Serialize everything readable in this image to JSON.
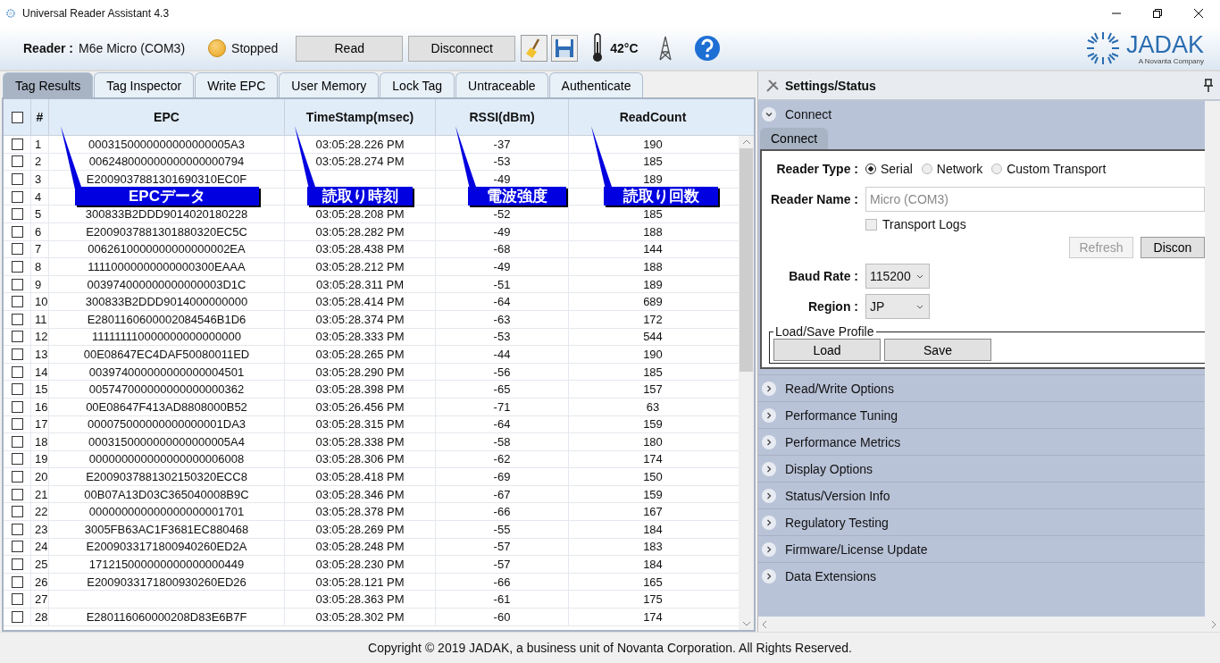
{
  "window": {
    "title": "Universal Reader Assistant 4.3"
  },
  "toolbar": {
    "reader_label": "Reader :",
    "reader_value": "M6e Micro (COM3)",
    "status": "Stopped",
    "buttons": [
      "Read",
      "Disconnect"
    ],
    "temperature": "42°C"
  },
  "logo": {
    "name": "JADAK",
    "tagline": "A Novanta Company"
  },
  "tabs": [
    {
      "label": "Tag Results",
      "selected": true
    },
    {
      "label": "Tag Inspector",
      "selected": false
    },
    {
      "label": "Write EPC",
      "selected": false
    },
    {
      "label": "User Memory",
      "selected": false
    },
    {
      "label": "Lock Tag",
      "selected": false
    },
    {
      "label": "Untraceable",
      "selected": false
    },
    {
      "label": "Authenticate",
      "selected": false
    }
  ],
  "table": {
    "select_all_checked": false,
    "columns": [
      "#",
      "EPC",
      "TimeStamp(msec)",
      "RSSI(dBm)",
      "ReadCount"
    ],
    "rows": [
      {
        "checked": false,
        "n": "1",
        "epc": "0003150000000000000005A3",
        "time": "03:05:28.226 PM",
        "rssi": "-37",
        "count": "190"
      },
      {
        "checked": false,
        "n": "2",
        "epc": "006248000000000000000794",
        "time": "03:05:28.274 PM",
        "rssi": "-53",
        "count": "185"
      },
      {
        "checked": false,
        "n": "3",
        "epc": "E2009037881301690310EC0F",
        "time": null,
        "rssi": "-49",
        "count": "189"
      },
      {
        "checked": false,
        "n": "4",
        "epc": null,
        "time": null,
        "rssi": null,
        "count": null
      },
      {
        "checked": false,
        "n": "5",
        "epc": "300833B2DDD9014020180228",
        "time": "03:05:28.208 PM",
        "rssi": "-52",
        "count": "185"
      },
      {
        "checked": false,
        "n": "6",
        "epc": "E2009037881301880320EC5C",
        "time": "03:05:28.282 PM",
        "rssi": "-49",
        "count": "188"
      },
      {
        "checked": false,
        "n": "7",
        "epc": "0062610000000000000002EA",
        "time": "03:05:28.438 PM",
        "rssi": "-68",
        "count": "144"
      },
      {
        "checked": false,
        "n": "8",
        "epc": "11110000000000000300EAAA",
        "time": "03:05:28.212 PM",
        "rssi": "-49",
        "count": "188"
      },
      {
        "checked": false,
        "n": "9",
        "epc": "003974000000000000003D1C",
        "time": "03:05:28.311 PM",
        "rssi": "-51",
        "count": "189"
      },
      {
        "checked": false,
        "n": "10",
        "epc": "300833B2DDD9014000000000",
        "time": "03:05:28.414 PM",
        "rssi": "-64",
        "count": "689"
      },
      {
        "checked": false,
        "n": "11",
        "epc": "E2801160600002084546B1D6",
        "time": "03:05:28.374 PM",
        "rssi": "-63",
        "count": "172"
      },
      {
        "checked": false,
        "n": "12",
        "epc": "111111110000000000000000",
        "time": "03:05:28.333 PM",
        "rssi": "-53",
        "count": "544"
      },
      {
        "checked": false,
        "n": "13",
        "epc": "00E08647EC4DAF50080011ED",
        "time": "03:05:28.265 PM",
        "rssi": "-44",
        "count": "190"
      },
      {
        "checked": false,
        "n": "14",
        "epc": "003974000000000000004501",
        "time": "03:05:28.290 PM",
        "rssi": "-56",
        "count": "185"
      },
      {
        "checked": false,
        "n": "15",
        "epc": "005747000000000000000362",
        "time": "03:05:28.398 PM",
        "rssi": "-65",
        "count": "157"
      },
      {
        "checked": false,
        "n": "16",
        "epc": "00E08647F413AD8808000B52",
        "time": "03:05:26.456 PM",
        "rssi": "-71",
        "count": "63"
      },
      {
        "checked": false,
        "n": "17",
        "epc": "000075000000000000001DA3",
        "time": "03:05:28.315 PM",
        "rssi": "-64",
        "count": "159"
      },
      {
        "checked": false,
        "n": "18",
        "epc": "0003150000000000000005A4",
        "time": "03:05:28.338 PM",
        "rssi": "-58",
        "count": "180"
      },
      {
        "checked": false,
        "n": "19",
        "epc": "000000000000000000006008",
        "time": "03:05:28.306 PM",
        "rssi": "-62",
        "count": "174"
      },
      {
        "checked": false,
        "n": "20",
        "epc": "E2009037881302150320ECC8",
        "time": "03:05:28.418 PM",
        "rssi": "-69",
        "count": "150"
      },
      {
        "checked": false,
        "n": "21",
        "epc": "00B07A13D03C365040008B9C",
        "time": "03:05:28.346 PM",
        "rssi": "-67",
        "count": "159"
      },
      {
        "checked": false,
        "n": "22",
        "epc": "000000000000000000001701",
        "time": "03:05:28.378 PM",
        "rssi": "-66",
        "count": "167"
      },
      {
        "checked": false,
        "n": "23",
        "epc": "3005FB63AC1F3681EC880468",
        "time": "03:05:28.269 PM",
        "rssi": "-55",
        "count": "184"
      },
      {
        "checked": false,
        "n": "24",
        "epc": "E2009033171800940260ED2A",
        "time": "03:05:28.248 PM",
        "rssi": "-57",
        "count": "183"
      },
      {
        "checked": false,
        "n": "25",
        "epc": "171215000000000000000449",
        "time": "03:05:28.230 PM",
        "rssi": "-57",
        "count": "184"
      },
      {
        "checked": false,
        "n": "26",
        "epc": "E2009033171800930260ED26",
        "time": "03:05:28.121 PM",
        "rssi": "-66",
        "count": "165"
      },
      {
        "checked": false,
        "n": "27",
        "epc": null,
        "time": "03:05:28.363 PM",
        "rssi": "-61",
        "count": "175"
      },
      {
        "checked": false,
        "n": "28",
        "epc": "E280116060000208D83E6B7F",
        "time": "03:05:28.302 PM",
        "rssi": "-60",
        "count": "174"
      }
    ]
  },
  "callouts": [
    "EPCデータ",
    "読取り時刻",
    "電波強度",
    "読取り回数"
  ],
  "settings": {
    "title": "Settings/Status",
    "connect": {
      "label": "Connect",
      "expanded": true,
      "tab": "Connect",
      "reader_type_label": "Reader Type :",
      "reader_types": [
        {
          "label": "Serial",
          "selected": true
        },
        {
          "label": "Network",
          "selected": false
        },
        {
          "label": "Custom Transport",
          "selected": false
        }
      ],
      "reader_name_label": "Reader Name :",
      "reader_name": "Micro (COM3)",
      "transport_logs": {
        "label": "Transport Logs",
        "checked": false
      },
      "buttons": [
        {
          "label": "Refresh",
          "disabled": true
        },
        {
          "label": "Discon",
          "disabled": false
        }
      ],
      "baud_label": "Baud Rate :",
      "baud": "115200",
      "region_label": "Region :",
      "region": "JP",
      "profile_legend": "Load/Save Profile",
      "profile_buttons": [
        "Load",
        "Save"
      ]
    },
    "sections": [
      {
        "label": "Read/Write Options",
        "expanded": false
      },
      {
        "label": "Performance Tuning",
        "expanded": false
      },
      {
        "label": "Performance Metrics",
        "expanded": false
      },
      {
        "label": "Display Options",
        "expanded": false
      },
      {
        "label": "Status/Version Info",
        "expanded": false
      },
      {
        "label": "Regulatory Testing",
        "expanded": false
      },
      {
        "label": "Firmware/License Update",
        "expanded": false
      },
      {
        "label": "Data Extensions",
        "expanded": false
      }
    ]
  },
  "footer": "Copyright © 2019 JADAK, a business unit of Novanta Corporation. All Rights Reserved."
}
